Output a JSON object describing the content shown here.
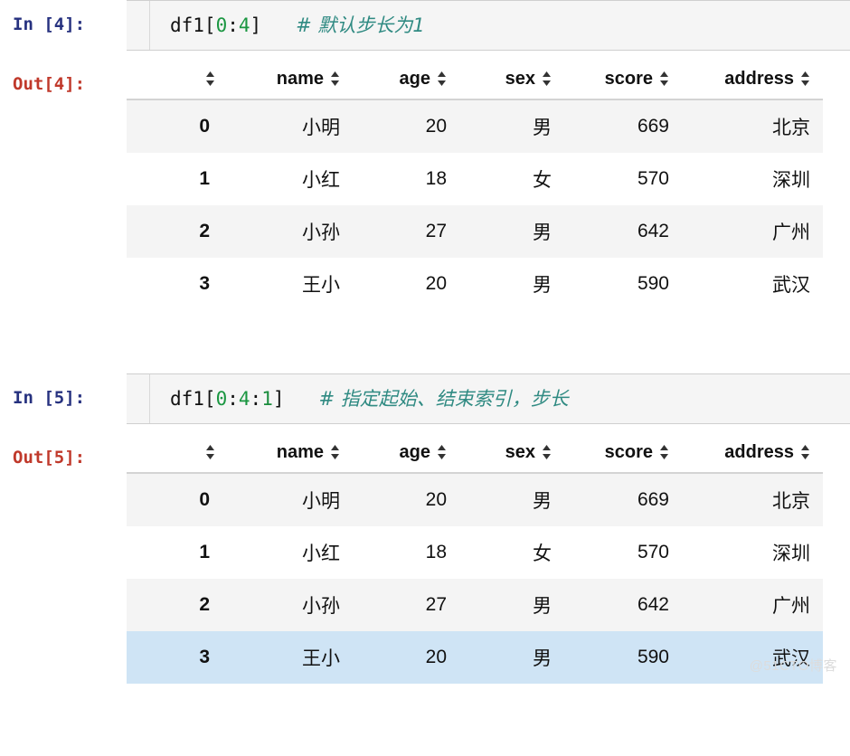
{
  "watermark": "@51CTO博客",
  "icons": {
    "sort": "sort-arrows-icon"
  },
  "table": {
    "columns": [
      {
        "key": "index",
        "label": ""
      },
      {
        "key": "name",
        "label": "name"
      },
      {
        "key": "age",
        "label": "age"
      },
      {
        "key": "sex",
        "label": "sex"
      },
      {
        "key": "score",
        "label": "score"
      },
      {
        "key": "address",
        "label": "address"
      }
    ],
    "rows": [
      {
        "index": "0",
        "name": "小明",
        "age": "20",
        "sex": "男",
        "score": "669",
        "address": "北京"
      },
      {
        "index": "1",
        "name": "小红",
        "age": "18",
        "sex": "女",
        "score": "570",
        "address": "深圳"
      },
      {
        "index": "2",
        "name": "小孙",
        "age": "27",
        "sex": "男",
        "score": "642",
        "address": "广州"
      },
      {
        "index": "3",
        "name": "王小",
        "age": "20",
        "sex": "男",
        "score": "590",
        "address": "武汉"
      }
    ]
  },
  "cells": [
    {
      "in_prompt": "In [4]:",
      "out_prompt": "Out[4]:",
      "code": {
        "expr_prefix": "df1[",
        "slice_start": "0",
        "slice_colon1": ":",
        "slice_stop": "4",
        "expr_suffix": "]",
        "comment": "# 默认步长为1"
      },
      "highlight_row": -1
    },
    {
      "in_prompt": "In [5]:",
      "out_prompt": "Out[5]:",
      "code": {
        "expr_prefix": "df1[",
        "slice_start": "0",
        "slice_colon1": ":",
        "slice_stop": "4",
        "slice_colon2": ":",
        "slice_step": "1",
        "expr_suffix": "]",
        "comment": "# 指定起始、结束索引，步长"
      },
      "highlight_row": 3
    }
  ],
  "colors": {
    "prompt_in": "#26317f",
    "prompt_out": "#c0392b",
    "code_number": "#1a9641",
    "code_comment": "#2f8a82",
    "input_bg": "#f5f5f5",
    "row_stripe": "#f4f4f4",
    "row_highlight": "#cfe4f5"
  }
}
